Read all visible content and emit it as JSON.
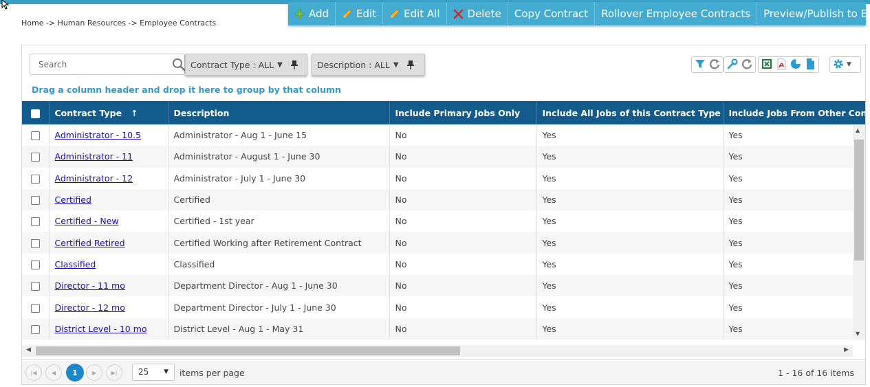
{
  "breadcrumb": "Home -> Human Resources -> Employee Contracts",
  "toolbar": {
    "add": "Add",
    "edit": "Edit",
    "edit_all": "Edit All",
    "delete": "Delete",
    "copy_contract": "Copy Contract",
    "rollover": "Rollover Employee Contracts",
    "preview_publish": "Preview/Publish to ESS"
  },
  "search": {
    "placeholder": "Search"
  },
  "filters": {
    "contract_type": "Contract Type : ALL",
    "description": "Description : ALL"
  },
  "group_hint": "Drag a column header and drop it here to group by that column",
  "columns": {
    "contract_type": "Contract Type",
    "description": "Description",
    "primary_only": "Include Primary Jobs Only",
    "all_jobs": "Include All Jobs of this Contract Type",
    "other_jobs": "Include Jobs From Other Con"
  },
  "sort_indicator": "↑",
  "rows": [
    {
      "type": "Administrator - 10.5",
      "desc": "Administrator - Aug 1 - June 15",
      "primary": "No",
      "all": "Yes",
      "other": "Yes"
    },
    {
      "type": "Administrator - 11",
      "desc": "Administrator - August 1 - June 30",
      "primary": "No",
      "all": "Yes",
      "other": "Yes"
    },
    {
      "type": "Administrator - 12",
      "desc": "Administrator - July 1 - June 30",
      "primary": "No",
      "all": "Yes",
      "other": "Yes"
    },
    {
      "type": "Certified",
      "desc": "Certified",
      "primary": "No",
      "all": "Yes",
      "other": "Yes"
    },
    {
      "type": "Certified - New",
      "desc": "Certified - 1st year",
      "primary": "No",
      "all": "Yes",
      "other": "Yes"
    },
    {
      "type": "Certified Retired",
      "desc": "Certified Working after Retirement Contract",
      "primary": "No",
      "all": "Yes",
      "other": "Yes"
    },
    {
      "type": "Classified",
      "desc": "Classified",
      "primary": "No",
      "all": "Yes",
      "other": "Yes"
    },
    {
      "type": "Director - 11 mo",
      "desc": "Department Director - Aug 1 - June 30",
      "primary": "No",
      "all": "Yes",
      "other": "Yes"
    },
    {
      "type": "Director - 12 mo",
      "desc": "Department Director - July 1 - June 30",
      "primary": "No",
      "all": "Yes",
      "other": "Yes"
    },
    {
      "type": "District Level - 10 mo",
      "desc": "District Level - Aug 1 - May 31",
      "primary": "No",
      "all": "Yes",
      "other": "Yes"
    }
  ],
  "pager": {
    "current_page": "1",
    "page_size": "25",
    "per_page_label": "items per page",
    "info": "1 - 16 of 16 items"
  },
  "colors": {
    "toolbar": "#44abd1",
    "header": "#125b8c",
    "link": "#1a0dab",
    "page_active": "#1e87c8"
  }
}
